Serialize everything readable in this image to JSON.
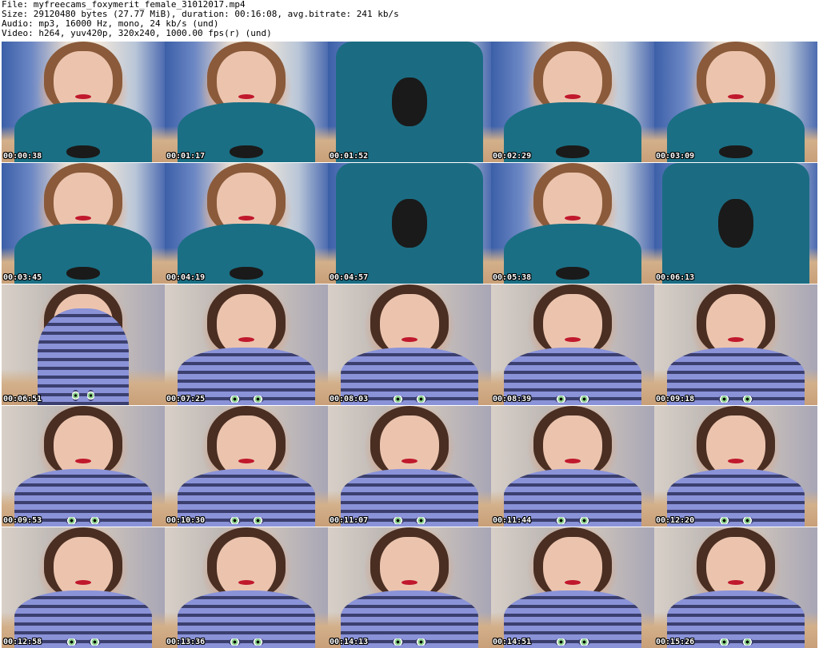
{
  "header": {
    "file": "File: myfreecams_foxymerit_female_31012017.mp4",
    "size": "Size: 29120480 bytes (27.77 MiB), duration: 00:16:08, avg.bitrate: 241 kb/s",
    "audio": "Audio: mp3, 16000 Hz, mono, 24 kb/s (und)",
    "video": "Video: h264, yuv420p, 320x240, 1000.00 fps(r) (und)"
  },
  "thumbnails": [
    {
      "timestamp": "00:00:38",
      "scene": "sweater"
    },
    {
      "timestamp": "00:01:17",
      "scene": "sweater"
    },
    {
      "timestamp": "00:01:52",
      "scene": "sweater-big"
    },
    {
      "timestamp": "00:02:29",
      "scene": "sweater"
    },
    {
      "timestamp": "00:03:09",
      "scene": "sweater"
    },
    {
      "timestamp": "00:03:45",
      "scene": "sweater"
    },
    {
      "timestamp": "00:04:19",
      "scene": "sweater"
    },
    {
      "timestamp": "00:04:57",
      "scene": "sweater-big"
    },
    {
      "timestamp": "00:05:38",
      "scene": "sweater"
    },
    {
      "timestamp": "00:06:13",
      "scene": "sweater-big"
    },
    {
      "timestamp": "00:06:51",
      "scene": "shirt-full"
    },
    {
      "timestamp": "00:07:25",
      "scene": "shirt"
    },
    {
      "timestamp": "00:08:03",
      "scene": "shirt"
    },
    {
      "timestamp": "00:08:39",
      "scene": "shirt"
    },
    {
      "timestamp": "00:09:18",
      "scene": "shirt"
    },
    {
      "timestamp": "00:09:53",
      "scene": "shirt"
    },
    {
      "timestamp": "00:10:30",
      "scene": "shirt"
    },
    {
      "timestamp": "00:11:07",
      "scene": "shirt"
    },
    {
      "timestamp": "00:11:44",
      "scene": "shirt"
    },
    {
      "timestamp": "00:12:20",
      "scene": "shirt"
    },
    {
      "timestamp": "00:12:58",
      "scene": "shirt"
    },
    {
      "timestamp": "00:13:36",
      "scene": "shirt"
    },
    {
      "timestamp": "00:14:13",
      "scene": "shirt"
    },
    {
      "timestamp": "00:14:51",
      "scene": "shirt"
    },
    {
      "timestamp": "00:15:26",
      "scene": "shirt"
    }
  ],
  "colors": {
    "sweater": "#1a6f84",
    "shirt_stripe_light": "#8a93d8",
    "shirt_stripe_dark": "#3b3f6e",
    "lips": "#c0182c"
  }
}
